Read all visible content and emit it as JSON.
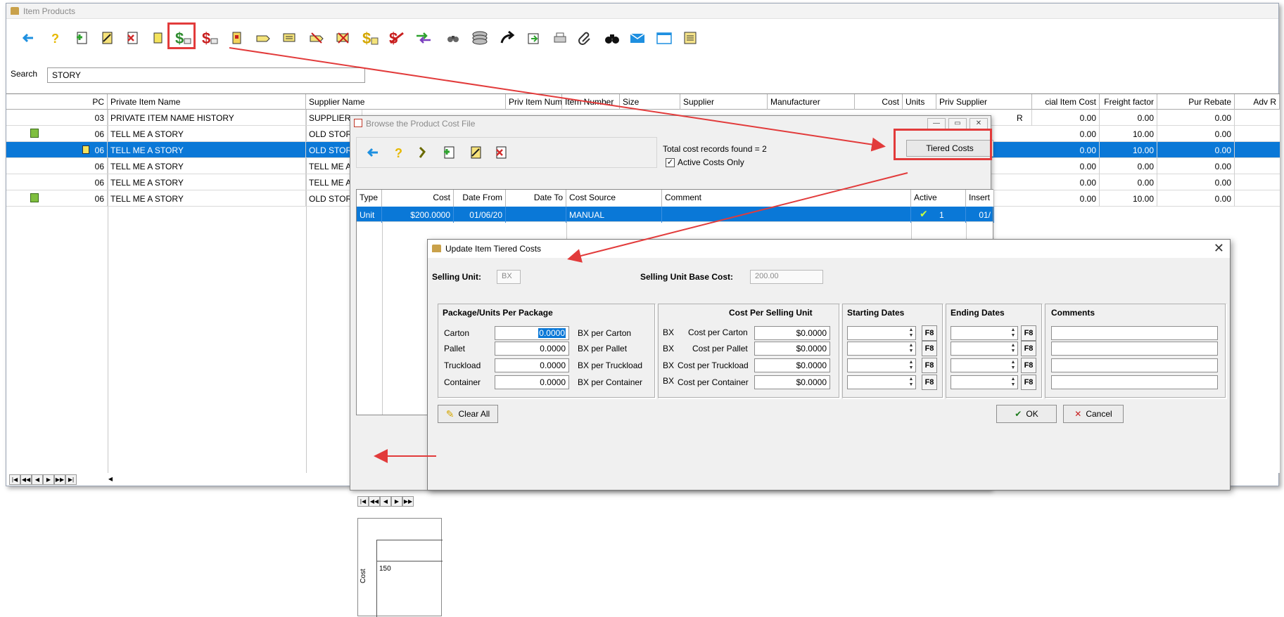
{
  "main_window": {
    "title": "Item Products",
    "toolbar_icons": [
      "back-arrow-icon",
      "help-icon",
      "add-icon",
      "edit-icon",
      "delete-icon",
      "note-icon",
      "dollar-price-icon",
      "dollar-cost-icon",
      "book-icon",
      "tag-icon",
      "list-icon",
      "cross-tag-icon",
      "cancel-list-icon",
      "dollar-page-icon",
      "no-pricing-icon",
      "transfer-arrows-icon",
      "binoculars-small-icon",
      "stack-icon",
      "forward-arrow-icon",
      "export-icon",
      "printer-icon",
      "paperclip-icon",
      "binoculars-icon",
      "email-icon",
      "window-icon",
      "notes-icon"
    ],
    "search_label": "Search",
    "search_value": "STORY",
    "grid": {
      "headers": [
        "PC",
        "Private Item Name",
        "Supplier Name",
        "Priv Item Num",
        "Item Number",
        "Size",
        "Supplier",
        "Manufacturer",
        "Cost",
        "Units",
        "Priv Supplier",
        "cial Item Cost",
        "Freight factor",
        "Pur Rebate",
        "Adv R"
      ],
      "rows": [
        {
          "pc": "03",
          "name": "PRIVATE  ITEM NAME HISTORY",
          "supplier": "SUPPLIER",
          "priv_supplier": "R",
          "special": "0.00",
          "freight": "0.00",
          "rebate": "0.00"
        },
        {
          "pc": "06",
          "name": "TELL ME A STORY",
          "supplier": "OLD STORI",
          "priv_supplier": "",
          "special": "0.00",
          "freight": "10.00",
          "rebate": "0.00"
        },
        {
          "pc": "06",
          "name": "TELL ME A STORY",
          "supplier": "OLD STORI",
          "priv_supplier": "",
          "special": "0.00",
          "freight": "10.00",
          "rebate": "0.00"
        },
        {
          "pc": "06",
          "name": "TELL ME A STORY",
          "supplier": "TELL ME A",
          "priv_supplier": "",
          "special": "0.00",
          "freight": "0.00",
          "rebate": "0.00"
        },
        {
          "pc": "06",
          "name": "TELL ME A STORY",
          "supplier": "TELL ME A",
          "priv_supplier": "",
          "special": "0.00",
          "freight": "0.00",
          "rebate": "0.00"
        },
        {
          "pc": "06",
          "name": "TELL ME A STORY",
          "supplier": "OLD STORI",
          "priv_supplier": "",
          "special": "0.00",
          "freight": "10.00",
          "rebate": "0.00"
        }
      ]
    },
    "nav_buttons": [
      "|◀",
      "◀◀",
      "◀",
      "▶",
      "▶▶",
      "▶|",
      "◀"
    ]
  },
  "browse_window": {
    "title": "Browse the Product Cost File",
    "toolbar_icons": [
      "back-arrow-icon",
      "help-icon",
      "wrench-icon",
      "add-icon",
      "edit-icon",
      "delete-icon"
    ],
    "records_found": "Total cost records found = 2",
    "active_only_label": "Active Costs Only",
    "active_only_checked": true,
    "tiered_button": "Tiered Costs",
    "grid": {
      "headers": [
        "Type",
        "Cost",
        "Date From",
        "Date To",
        "Cost Source",
        "Comment",
        "Active",
        "Insert"
      ],
      "row": {
        "type": "Unit",
        "cost": "$200.0000",
        "date_from": "01/06/20",
        "date_to": "",
        "source": "MANUAL",
        "comment": "",
        "active": "1",
        "insert": "01/"
      }
    },
    "nav_buttons": [
      "|◀",
      "◀◀",
      "◀",
      "▶",
      "▶▶"
    ],
    "chart": {
      "tick_label": "150",
      "axis_label": "Cost"
    }
  },
  "tier_dialog": {
    "title": "Update Item Tiered Costs",
    "selling_unit_label": "Selling Unit:",
    "selling_unit_value": "BX",
    "base_cost_label": "Selling Unit Base Cost:",
    "base_cost_value": "200.00",
    "pkg_title": "Package/Units Per Package",
    "cost_title": "Cost Per Selling Unit",
    "start_title": "Starting Dates",
    "end_title": "Ending Dates",
    "comments_title": "Comments",
    "packages": [
      {
        "name": "Carton",
        "qty": "0.0000",
        "per": "BX  per Carton",
        "unit": "BX",
        "cost_label": "Cost per Carton",
        "cost": "$0.0000"
      },
      {
        "name": "Pallet",
        "qty": "0.0000",
        "per": "BX  per Pallet",
        "unit": "BX",
        "cost_label": "Cost per Pallet",
        "cost": "$0.0000"
      },
      {
        "name": "Truckload",
        "qty": "0.0000",
        "per": "BX  per Truckload",
        "unit": "BX",
        "cost_label": "Cost per Truckload",
        "cost": "$0.0000"
      },
      {
        "name": "Container",
        "qty": "0.0000",
        "per": "BX  per Container",
        "unit": "BX",
        "cost_label": "Cost per Container",
        "cost": "$0.0000"
      }
    ],
    "f8_label": "F8",
    "clear_all": "Clear All",
    "ok": "OK",
    "cancel": "Cancel"
  },
  "colors": {
    "selection": "#0a78d7",
    "annotation": "#e23b3b",
    "dollar_green": "#2e8b2e"
  }
}
